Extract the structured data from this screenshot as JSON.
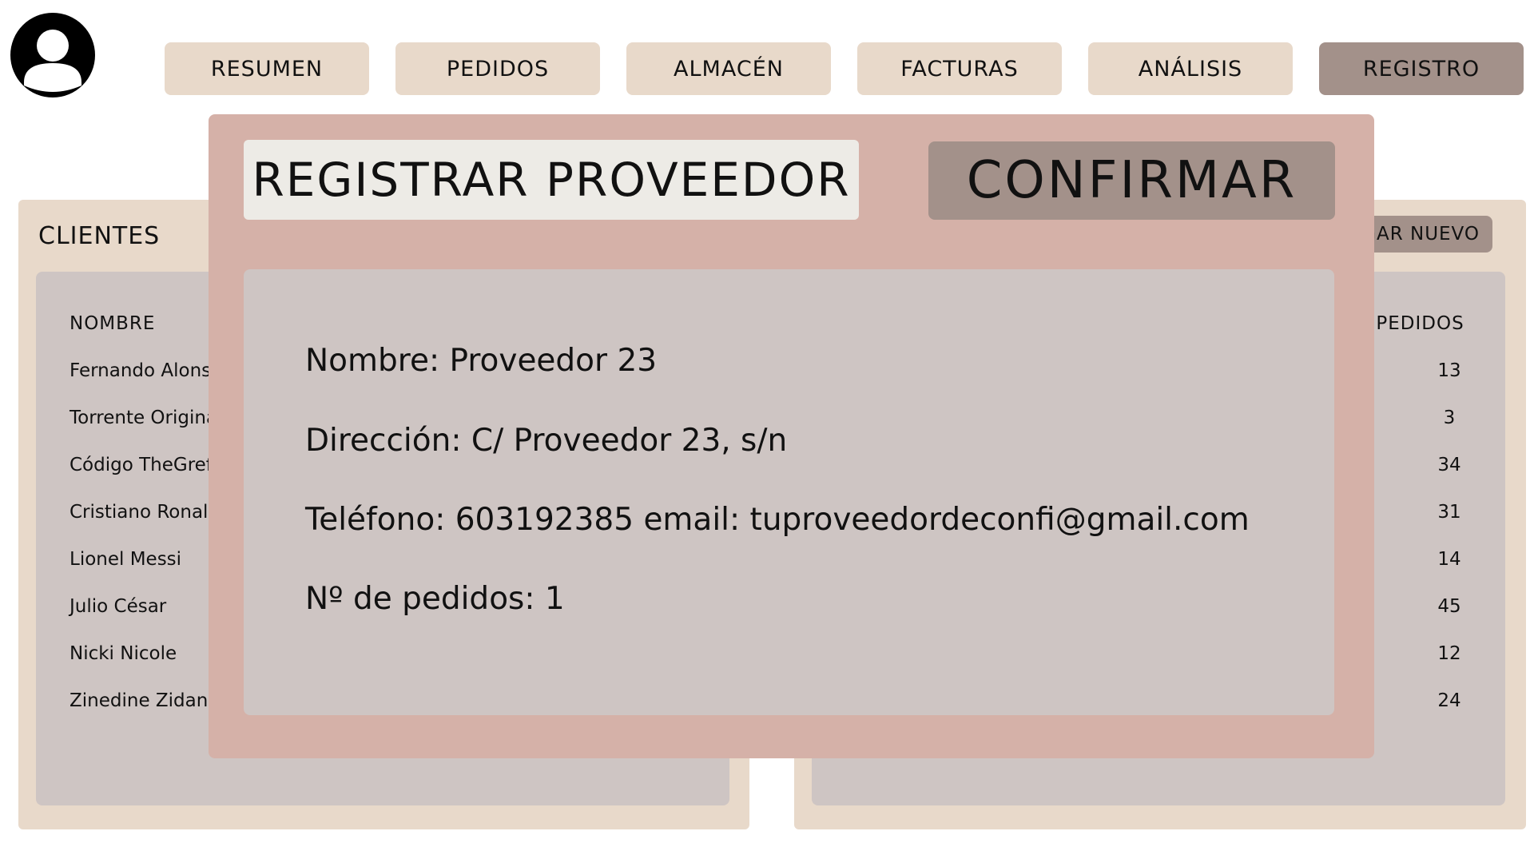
{
  "header": {
    "avatar_icon": "user-avatar-icon",
    "tabs": [
      {
        "label": "RESUMEN",
        "active": false
      },
      {
        "label": "PEDIDOS",
        "active": false
      },
      {
        "label": "ALMACÉN",
        "active": false
      },
      {
        "label": "FACTURAS",
        "active": false
      },
      {
        "label": "ANÁLISIS",
        "active": false
      },
      {
        "label": "REGISTRO",
        "active": true
      }
    ]
  },
  "clients_panel": {
    "title": "CLIENTES",
    "columns": {
      "name": "NOMBRE"
    },
    "rows": [
      "Fernando Alonso",
      "Torrente Original",
      "Código TheGrefg",
      "Cristiano Ronaldo",
      "Lionel Messi",
      "Julio César",
      "Nicki Nicole",
      "Zinedine Zidane"
    ]
  },
  "providers_panel": {
    "add_button": "AGREGAR NUEVO",
    "columns": {
      "orders": "Nº PEDIDOS"
    },
    "orders": [
      "13",
      "3",
      "34",
      "31",
      "14",
      "45",
      "12",
      "24"
    ]
  },
  "modal": {
    "title": "REGISTRAR PROVEEDOR",
    "confirm_label": "CONFIRMAR",
    "fields": {
      "name": "Nombre: Proveedor 23",
      "address": "Dirección: C/ Proveedor 23, s/n",
      "phone_email": "Teléfono: 603192385  email: tuproveedordeconfi@gmail.com",
      "orders": "Nº de pedidos: 1"
    }
  },
  "colors": {
    "tab": "#e8d9ca",
    "tab_active": "#a3918a",
    "panel": "#e8d9ca",
    "panel_inner": "#cec5c3",
    "modal": "#d5b1a8",
    "modal_title_bg": "#edebe6"
  }
}
